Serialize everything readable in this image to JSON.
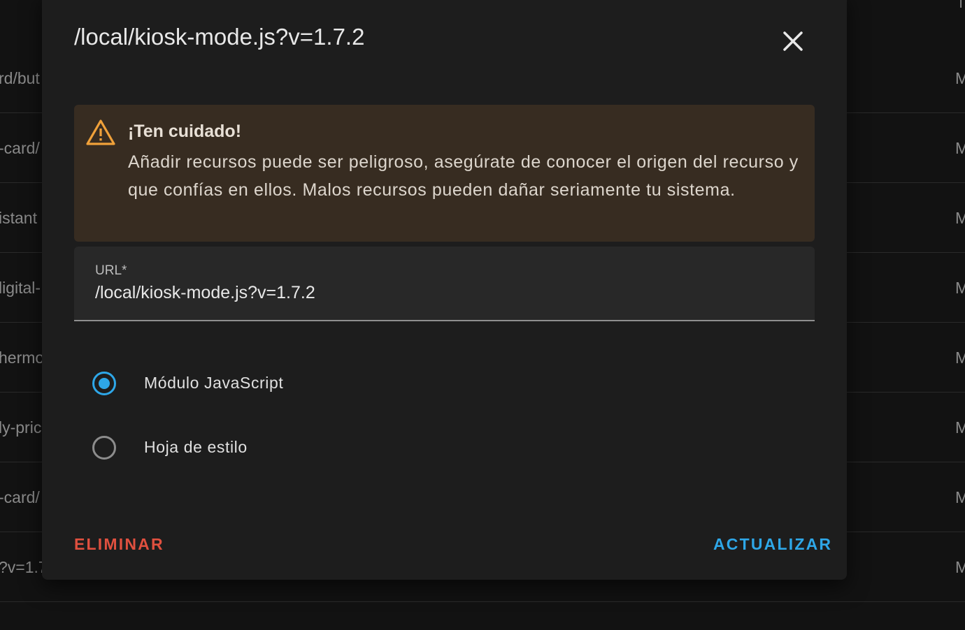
{
  "background": {
    "rows": [
      {
        "left_text": "rd/but",
        "right_text": "M"
      },
      {
        "left_text": "-card/",
        "right_text": "M"
      },
      {
        "left_text": "istant",
        "right_text": "M"
      },
      {
        "left_text": "ligital-",
        "right_text": "M"
      },
      {
        "left_text": "hermo",
        "right_text": "M"
      },
      {
        "left_text": "ly-pric",
        "right_text": "M"
      },
      {
        "left_text": "-card/",
        "right_text": "M"
      },
      {
        "left_text": "?v=1.7",
        "right_text": "M"
      }
    ],
    "top_right_text": "T"
  },
  "dialog": {
    "title": "/local/kiosk-mode.js?v=1.7.2",
    "close_icon": "close-icon",
    "warning": {
      "icon": "warning-icon",
      "title": "¡Ten cuidado!",
      "text": "Añadir recursos puede ser peligroso, asegúrate de conocer el origen del recurso y que confías en ellos. Malos recursos pueden dañar seriamente tu sistema."
    },
    "url_field": {
      "label": "URL*",
      "value": "/local/kiosk-mode.js?v=1.7.2"
    },
    "resource_type": {
      "options": [
        {
          "label": "Módulo JavaScript",
          "checked": true
        },
        {
          "label": "Hoja de estilo",
          "checked": false
        }
      ]
    },
    "actions": {
      "delete_label": "ELIMINAR",
      "update_label": "ACTUALIZAR"
    }
  },
  "colors": {
    "accent": "#2ea7e8",
    "danger": "#e0503f",
    "warning_icon": "#f0a13a",
    "warning_bg": "#372c21",
    "dialog_bg": "#1d1d1d"
  }
}
